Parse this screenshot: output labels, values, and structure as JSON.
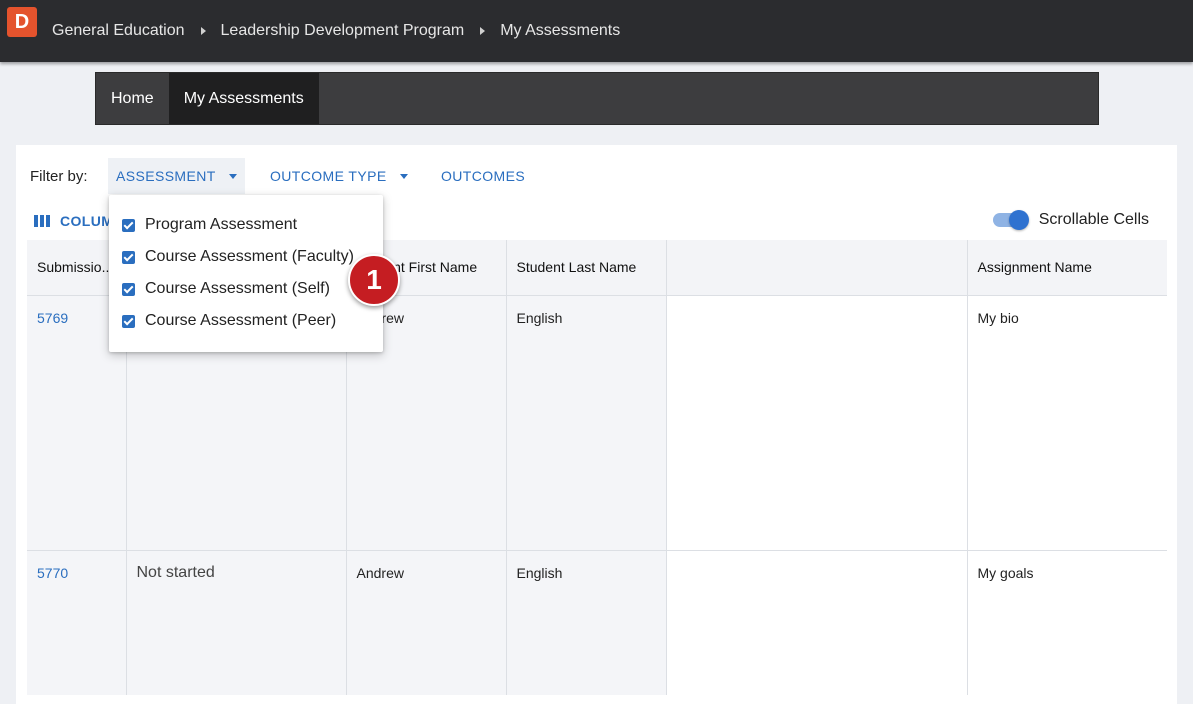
{
  "topbar": {
    "logo_letter": "D",
    "breadcrumbs": [
      "General Education",
      "Leadership Development Program",
      "My Assessments"
    ]
  },
  "nav": {
    "tabs": [
      {
        "label": "Home",
        "active": false
      },
      {
        "label": "My Assessments",
        "active": true
      }
    ]
  },
  "filters": {
    "label": "Filter by:",
    "buttons": [
      "ASSESSMENT",
      "OUTCOME TYPE",
      "OUTCOMES"
    ]
  },
  "toolbar": {
    "columns_label": "COLUMNS",
    "scrollable_label": "Scrollable Cells",
    "scrollable_on": true
  },
  "assessment_menu": {
    "options": [
      {
        "label": "Program Assessment",
        "checked": true
      },
      {
        "label": "Course Assessment (Faculty)",
        "checked": true
      },
      {
        "label": "Course Assessment (Self)",
        "checked": true
      },
      {
        "label": "Course Assessment (Peer)",
        "checked": true
      }
    ]
  },
  "table": {
    "headers": [
      "Submissio...",
      "",
      "Student First Name",
      "Student Last Name",
      "",
      "Assignment Name"
    ],
    "rows": [
      {
        "id": "5769",
        "status": "",
        "first": "Andrew",
        "last": "English",
        "blank": "",
        "assignment": "My bio"
      },
      {
        "id": "5770",
        "status": "Not started",
        "first": "Andrew",
        "last": "English",
        "blank": "",
        "assignment": "My goals"
      }
    ]
  },
  "callout": {
    "number": "1"
  },
  "colors": {
    "topbar": "#2b2c2f",
    "logo": "#e4532d",
    "accent": "#2a6ebf",
    "callout": "#c51d22"
  }
}
